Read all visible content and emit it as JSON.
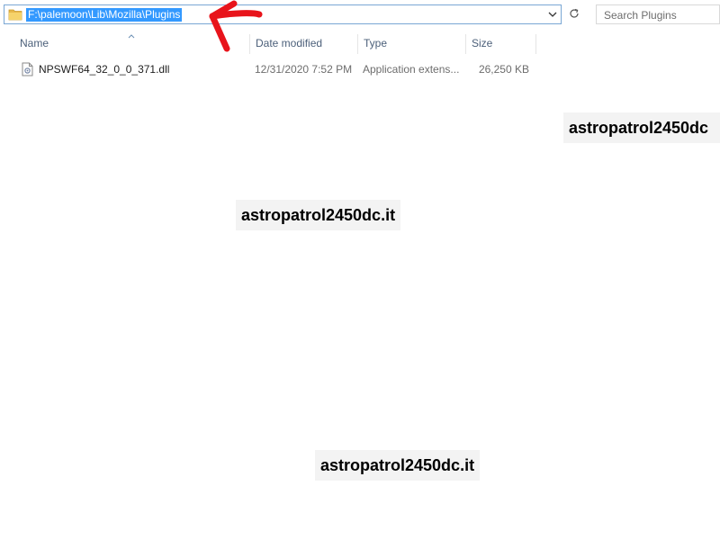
{
  "address_bar": {
    "path": "F:\\palemoon\\Lib\\Mozilla\\Plugins"
  },
  "search": {
    "placeholder": "Search Plugins"
  },
  "columns": [
    {
      "label": "Name"
    },
    {
      "label": "Date modified"
    },
    {
      "label": "Type"
    },
    {
      "label": "Size"
    }
  ],
  "files": [
    {
      "name": "NPSWF64_32_0_0_371.dll",
      "date_modified": "12/31/2020 7:52 PM",
      "type": "Application extens...",
      "size": "26,250 KB"
    }
  ],
  "watermarks": [
    {
      "text": "astropatrol2450dc"
    },
    {
      "text": "astropatrol2450dc.it"
    },
    {
      "text": "astropatrol2450dc.it"
    }
  ],
  "colors": {
    "selection": "#3399ff",
    "annotation_arrow": "#e8141b"
  },
  "icons": [
    "folder-icon",
    "chevron-down-icon",
    "refresh-icon",
    "sort-up-icon",
    "dll-file-icon"
  ]
}
